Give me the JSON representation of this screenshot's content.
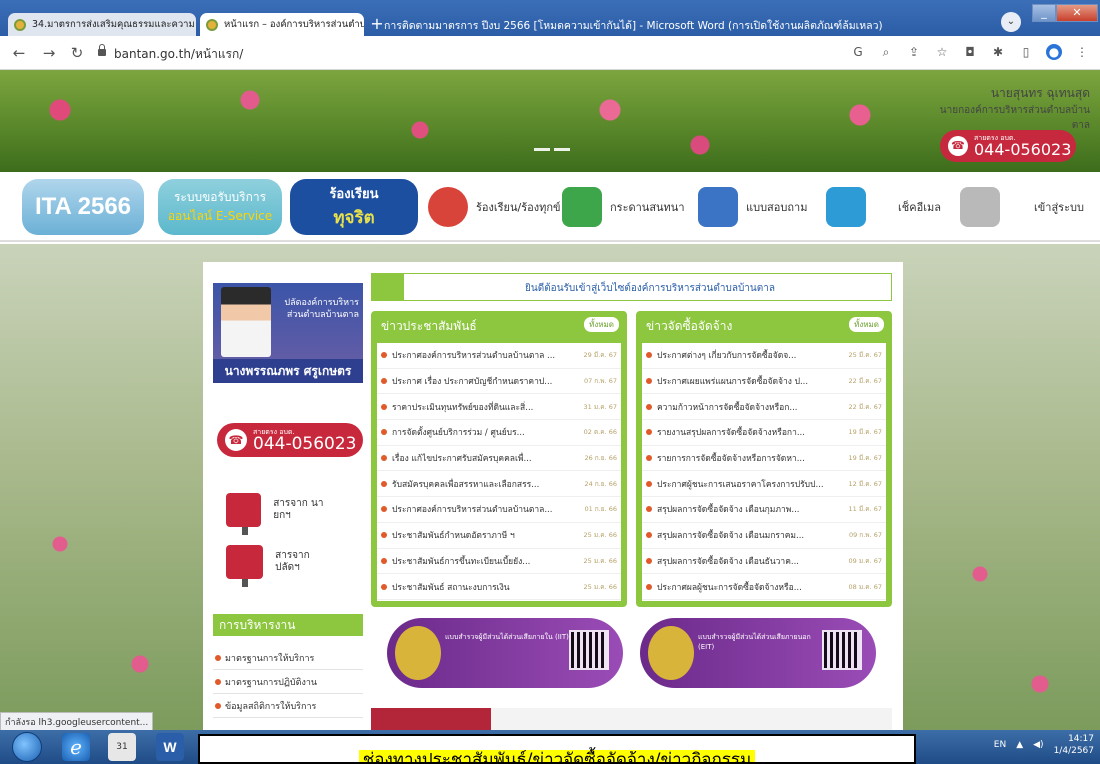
{
  "browser": {
    "tabs": [
      {
        "label": "34.มาตรการส่งเสริมคุณธรรมและความ"
      },
      {
        "label": "หน้าแรก – องค์การบริหารส่วนตำบลบ้านตาล"
      }
    ],
    "word_title": "การติดตามมาตรการ ปีงบ 2566 [โหมดความเข้ากันได้] - Microsoft Word (การเปิดใช้งานผลิตภัณฑ์ล้มเหลว)",
    "url": "bantan.go.th/หน้าแรก/",
    "status_text": "กำลังรอ lh3.googleusercontent..."
  },
  "banner": {
    "mayor_name": "นายสุนทร ฉุเทนสุด",
    "mayor_position": "นายกองค์การบริหารส่วนตำบลบ้านตาล",
    "hotline_label": "สายตรง อบต.",
    "hotline_number": "044-056023"
  },
  "quicklinks": {
    "ita": "ITA 2566",
    "eservice_top": "ระบบขอรับบริการ",
    "eservice_bottom": "ออนไลน์ E-Service",
    "corrupt_top": "ร้องเรียน",
    "corrupt_bottom": "ทุจริต",
    "complaint": "ร้องเรียน/ร้องทุกข์",
    "board": "กระดานสนทนา",
    "survey": "แบบสอบถาม",
    "email": "เช็คอีเมล",
    "login": "เข้าสู่ระบบ"
  },
  "profile": {
    "position": "ปลัดองค์การบริหารส่วนตำบลบ้านตาล",
    "name": "นางพรรณภพร ศรูเกษตร"
  },
  "sidebar": {
    "hotline_label": "สายตรง อบต.",
    "hotline_number": "044-056023",
    "mail_mayor": "สารจาก นายกฯ",
    "mail_clerk": "สารจาก ปลัดฯ",
    "mgmt_title": "การบริหารงาน",
    "mgmt_items": [
      "มาตรฐานการให้บริการ",
      "มาตรฐานการปฏิบัติงาน",
      "ข้อมูลสถิติการให้บริการ"
    ]
  },
  "welcome": "ยินดีต้อนรับเข้าสู่เว็บไซต์องค์การบริหารส่วนตำบลบ้านตาล",
  "pr_news": {
    "title": "ข่าวประชาสัมพันธ์",
    "all_label": "ทั้งหมด",
    "items": [
      {
        "title": "ประกาศองค์การบริหารส่วนตำบลบ้านตาล ...",
        "date": "29 มี.ค. 67"
      },
      {
        "title": "ประกาศ เรื่อง ประกาศบัญชีกำหนดราคาป...",
        "date": "07 ก.พ. 67"
      },
      {
        "title": "ราคาประเมินทุนทรัพย์ของที่ดินและสิ่...",
        "date": "31 ม.ค. 67"
      },
      {
        "title": "การจัดตั้งศูนย์บริการร่วม / ศูนย์บร...",
        "date": "02 ต.ค. 66"
      },
      {
        "title": "เรื่อง แก้ไขประกาศรับสมัครบุคคลเพื่...",
        "date": "26 ก.ย. 66"
      },
      {
        "title": "รับสมัครบุคคลเพื่อสรรหาและเลือกสรร...",
        "date": "24 ก.ย. 66"
      },
      {
        "title": "ประกาศองค์การบริหารส่วนตำบลบ้านตาล...",
        "date": "01 ก.ย. 66"
      },
      {
        "title": "ประชาสัมพันธ์กำหนดอัตราภาษี ฯ",
        "date": "25 ม.ค. 66"
      },
      {
        "title": "ประชาสัมพันธ์การขึ้นทะเบียนเบี้ยยัง...",
        "date": "25 ม.ค. 66"
      },
      {
        "title": "ประชาสัมพันธ์ สถานะงบการเงิน",
        "date": "25 ม.ค. 66"
      }
    ]
  },
  "procure_news": {
    "title": "ข่าวจัดซื้อจัดจ้าง",
    "all_label": "ทั้งหมด",
    "items": [
      {
        "title": "ประกาศต่างๆ เกี่ยวกับการจัดซื้อจัดจ...",
        "date": "25 มี.ค. 67"
      },
      {
        "title": "ประกาศเผยแพร่แผนการจัดซื้อจัดจ้าง ป...",
        "date": "22 มี.ค. 67"
      },
      {
        "title": "ความก้าวหน้าการจัดซื้อจัดจ้างหรือก...",
        "date": "22 มี.ค. 67"
      },
      {
        "title": "รายงานสรุปผลการจัดซื้อจัดจ้างหรือกา...",
        "date": "19 มี.ค. 67"
      },
      {
        "title": "รายการการจัดซื้อจัดจ้างหรือการจัดหา...",
        "date": "19 มี.ค. 67"
      },
      {
        "title": "ประกาศผู้ชนะการเสนอราคาโครงการปรับป...",
        "date": "12 มี.ค. 67"
      },
      {
        "title": "สรุปผลการจัดซื้อจัดจ้าง เดือนกุมภาพ...",
        "date": "11 มี.ค. 67"
      },
      {
        "title": "สรุปผลการจัดซื้อจัดจ้าง เดือนมกราคม...",
        "date": "09 ก.พ. 67"
      },
      {
        "title": "สรุปผลการจัดซื้อจัดจ้าง เดือนธันวาค...",
        "date": "09 ม.ค. 67"
      },
      {
        "title": "ประกาศผลผู้ชนะการจัดซื้อจัดจ้างหรือ...",
        "date": "08 ม.ค. 67"
      }
    ]
  },
  "ita_banners": [
    {
      "text": "แบบสำรวจผู้มีส่วนได้ส่วนเสียภายใน (IIT)"
    },
    {
      "text": "แบบสำรวจผู้มีส่วนได้ส่วนเสียภายนอก (EIT)"
    }
  ],
  "taskbar": {
    "lang": "EN",
    "time": "14:17",
    "date": "1/4/2567"
  },
  "caption": "ช่องทางประชาสัมพันธ์/ข่าวจัดซื้อจัดจ้าง/ข่าวกิจกรรม"
}
